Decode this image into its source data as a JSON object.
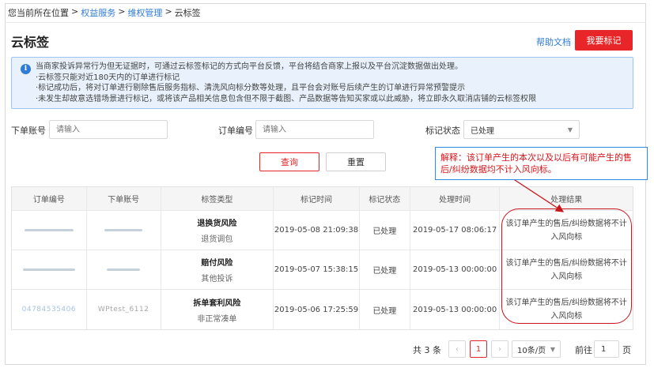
{
  "breadcrumb": {
    "prefix": "您当前所在位置",
    "items": [
      "权益服务",
      "维权管理",
      "云标签"
    ],
    "sep": ">"
  },
  "header": {
    "title": "云标签",
    "help_link": "帮助文档",
    "mark_button": "我要标记"
  },
  "notice": {
    "icon": "info-icon",
    "lines": [
      "当商家投诉异常行为但无证据时，可通过云标签标记的方式向平台反馈，平台将结合商家上报以及平台沉淀数据做出处理。",
      "·云标签只能对近180天内的订单进行标记",
      "·标记成功后，将对订单进行剔除售后服务指标、清洗风向标分数等处理，且平台会对账号后续产生的订单进行异常预警提示",
      "·未发生却故意选错场景进行标记，或将该产品相关信息包含但不限于截图、产品数据等告知买家或以此威胁，将立即永久取消店铺的云标签权限"
    ]
  },
  "filters": {
    "account_label": "下单账号",
    "account_placeholder": "请输入",
    "order_label": "订单编号",
    "order_placeholder": "请输入",
    "status_label": "标记状态",
    "status_value": "已处理"
  },
  "buttons": {
    "query": "查询",
    "reset": "重置"
  },
  "table": {
    "headers": [
      "订单编号",
      "下单账号",
      "标签类型",
      "标记时间",
      "标记状态",
      "处理时间",
      "处理结果"
    ],
    "rows": [
      {
        "tag_title": "退换货风险",
        "tag_sub": "退货调包",
        "mark_time": "2019-05-08 21:09:38",
        "status": "已处理",
        "process_time": "2019-05-17 08:06:17",
        "result": "该订单产生的售后/纠纷数据将不计入风向标"
      },
      {
        "tag_title": "赔付风险",
        "tag_sub": "其他投诉",
        "mark_time": "2019-05-07 15:38:15",
        "status": "已处理",
        "process_time": "2019-05-13 00:00:00",
        "result": "该订单产生的售后/纠纷数据将不计入风向标"
      },
      {
        "order_no": "04784535406",
        "account": "WPtest_6112",
        "tag_title": "拆单套利风险",
        "tag_sub": "非正常凑单",
        "mark_time": "2019-05-06 17:25:59",
        "status": "已处理",
        "process_time": "2019-05-13 00:00:00",
        "result": "该订单产生的售后/纠纷数据将不计入风向标"
      }
    ]
  },
  "pagination": {
    "total": "共 3 条",
    "prev": "‹",
    "current": "1",
    "next": "›",
    "page_size": "10条/页",
    "goto_label": "前往",
    "goto_value": "1",
    "page_suffix": "页"
  },
  "annotation": {
    "text": "解释：该订单产生的本次以及以后有可能产生的售后/纠纷数据均不计入风向标。",
    "color": "#d8141a"
  },
  "colors": {
    "accent": "#e8262a",
    "link": "#2f7cd8",
    "notice_bg": "#e9f2fc"
  }
}
